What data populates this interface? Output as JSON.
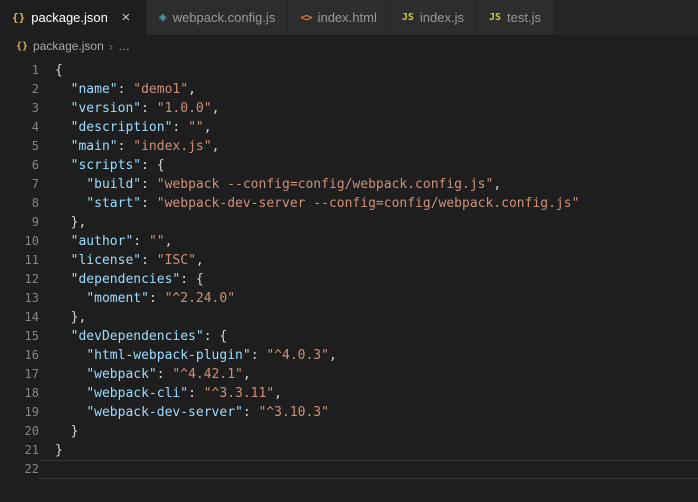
{
  "colors": {
    "editor_bg": "#1e1e1e",
    "tabbar_bg": "#252526",
    "inactive_tab_bg": "#2d2d2d",
    "json_key": "#9cdcfe",
    "json_string": "#ce9178",
    "punctuation": "#d4d4d4",
    "line_number": "#858585",
    "json_icon": "#d9b362",
    "html_icon": "#e37933",
    "js_icon": "#cbcb41",
    "webpack_icon": "#519aba"
  },
  "tabs": [
    {
      "label": "package.json",
      "icon": "json",
      "icon_text": "{}",
      "active": true,
      "close_label": "×"
    },
    {
      "label": "webpack.config.js",
      "icon": "webpack",
      "icon_text": "◈",
      "active": false
    },
    {
      "label": "index.html",
      "icon": "html",
      "icon_text": "<>",
      "active": false
    },
    {
      "label": "index.js",
      "icon": "js",
      "icon_text": "JS",
      "active": false
    },
    {
      "label": "test.js",
      "icon": "js",
      "icon_text": "JS",
      "active": false
    }
  ],
  "breadcrumb": {
    "icon_text": "{}",
    "file": "package.json",
    "separator": "›",
    "more": "…"
  },
  "editor": {
    "lines": [
      {
        "num": "1",
        "tokens": [
          [
            "p",
            "{"
          ]
        ]
      },
      {
        "num": "2",
        "tokens": [
          [
            "p",
            "  "
          ],
          [
            "k",
            "\"name\""
          ],
          [
            "p",
            ": "
          ],
          [
            "s",
            "\"demo1\""
          ],
          [
            "p",
            ","
          ]
        ]
      },
      {
        "num": "3",
        "tokens": [
          [
            "p",
            "  "
          ],
          [
            "k",
            "\"version\""
          ],
          [
            "p",
            ": "
          ],
          [
            "s",
            "\"1.0.0\""
          ],
          [
            "p",
            ","
          ]
        ]
      },
      {
        "num": "4",
        "tokens": [
          [
            "p",
            "  "
          ],
          [
            "k",
            "\"description\""
          ],
          [
            "p",
            ": "
          ],
          [
            "s",
            "\"\""
          ],
          [
            "p",
            ","
          ]
        ]
      },
      {
        "num": "5",
        "tokens": [
          [
            "p",
            "  "
          ],
          [
            "k",
            "\"main\""
          ],
          [
            "p",
            ": "
          ],
          [
            "s",
            "\"index.js\""
          ],
          [
            "p",
            ","
          ]
        ]
      },
      {
        "num": "6",
        "tokens": [
          [
            "p",
            "  "
          ],
          [
            "k",
            "\"scripts\""
          ],
          [
            "p",
            ": {"
          ]
        ]
      },
      {
        "num": "7",
        "tokens": [
          [
            "p",
            "    "
          ],
          [
            "k",
            "\"build\""
          ],
          [
            "p",
            ": "
          ],
          [
            "s",
            "\"webpack --config=config/webpack.config.js\""
          ],
          [
            "p",
            ","
          ]
        ]
      },
      {
        "num": "8",
        "tokens": [
          [
            "p",
            "    "
          ],
          [
            "k",
            "\"start\""
          ],
          [
            "p",
            ": "
          ],
          [
            "s",
            "\"webpack-dev-server --config=config/webpack.config.js\""
          ]
        ]
      },
      {
        "num": "9",
        "tokens": [
          [
            "p",
            "  },"
          ]
        ]
      },
      {
        "num": "10",
        "tokens": [
          [
            "p",
            "  "
          ],
          [
            "k",
            "\"author\""
          ],
          [
            "p",
            ": "
          ],
          [
            "s",
            "\"\""
          ],
          [
            "p",
            ","
          ]
        ]
      },
      {
        "num": "11",
        "tokens": [
          [
            "p",
            "  "
          ],
          [
            "k",
            "\"license\""
          ],
          [
            "p",
            ": "
          ],
          [
            "s",
            "\"ISC\""
          ],
          [
            "p",
            ","
          ]
        ]
      },
      {
        "num": "12",
        "tokens": [
          [
            "p",
            "  "
          ],
          [
            "k",
            "\"dependencies\""
          ],
          [
            "p",
            ": {"
          ]
        ]
      },
      {
        "num": "13",
        "tokens": [
          [
            "p",
            "    "
          ],
          [
            "k",
            "\"moment\""
          ],
          [
            "p",
            ": "
          ],
          [
            "s",
            "\"^2.24.0\""
          ]
        ]
      },
      {
        "num": "14",
        "tokens": [
          [
            "p",
            "  },"
          ]
        ]
      },
      {
        "num": "15",
        "tokens": [
          [
            "p",
            "  "
          ],
          [
            "k",
            "\"devDependencies\""
          ],
          [
            "p",
            ": {"
          ]
        ]
      },
      {
        "num": "16",
        "tokens": [
          [
            "p",
            "    "
          ],
          [
            "k",
            "\"html-webpack-plugin\""
          ],
          [
            "p",
            ": "
          ],
          [
            "s",
            "\"^4.0.3\""
          ],
          [
            "p",
            ","
          ]
        ]
      },
      {
        "num": "17",
        "tokens": [
          [
            "p",
            "    "
          ],
          [
            "k",
            "\"webpack\""
          ],
          [
            "p",
            ": "
          ],
          [
            "s",
            "\"^4.42.1\""
          ],
          [
            "p",
            ","
          ]
        ]
      },
      {
        "num": "18",
        "tokens": [
          [
            "p",
            "    "
          ],
          [
            "k",
            "\"webpack-cli\""
          ],
          [
            "p",
            ": "
          ],
          [
            "s",
            "\"^3.3.11\""
          ],
          [
            "p",
            ","
          ]
        ]
      },
      {
        "num": "19",
        "tokens": [
          [
            "p",
            "    "
          ],
          [
            "k",
            "\"webpack-dev-server\""
          ],
          [
            "p",
            ": "
          ],
          [
            "s",
            "\"^3.10.3\""
          ]
        ]
      },
      {
        "num": "20",
        "tokens": [
          [
            "p",
            "  }"
          ]
        ]
      },
      {
        "num": "21",
        "tokens": [
          [
            "p",
            "}"
          ]
        ]
      },
      {
        "num": "22",
        "tokens": [],
        "current": true
      }
    ]
  }
}
